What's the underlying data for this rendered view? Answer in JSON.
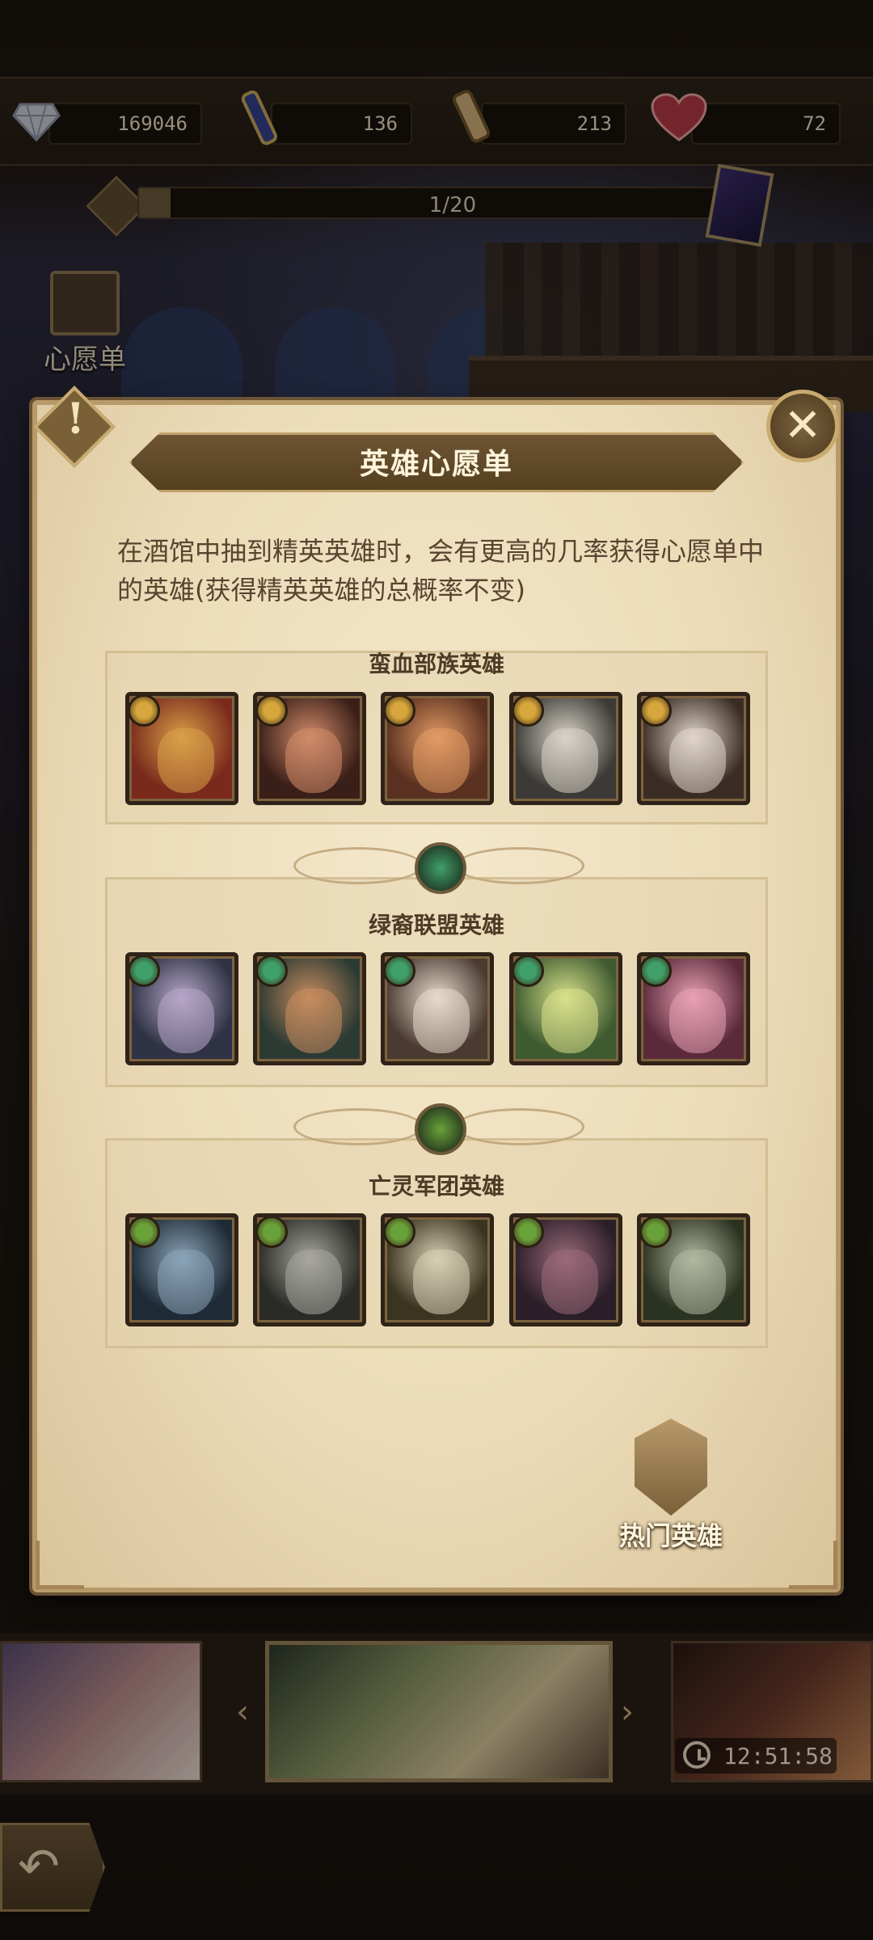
{
  "resources": {
    "diamonds": "169046",
    "scrolls_purple": "136",
    "scrolls_gold": "213",
    "hearts": "72"
  },
  "summon_progress": {
    "text": "1/20",
    "fraction": 0.05
  },
  "side_nav": {
    "wishlist_label": "心愿单"
  },
  "modal": {
    "title": "英雄心愿单",
    "description": "在酒馆中抽到精英英雄时，会有更高的几率获得心愿单中的英雄(获得精英英雄的总概率不变)",
    "sections": [
      {
        "title": "蛮血部族英雄",
        "badge_color": "#d7a63c",
        "heroes": [
          "hero-1",
          "hero-2",
          "hero-3",
          "hero-4",
          "hero-5"
        ]
      },
      {
        "title": "绿裔联盟英雄",
        "badge_color": "#3fa06a",
        "heroes": [
          "hero-1",
          "hero-2",
          "hero-3",
          "hero-4",
          "hero-5"
        ]
      },
      {
        "title": "亡灵军团英雄",
        "badge_color": "#6aa23a",
        "heroes": [
          "hero-1",
          "hero-2",
          "hero-3",
          "hero-4",
          "hero-5"
        ]
      }
    ],
    "hot_heroes_label": "热门英雄"
  },
  "banner": {
    "timer": "12:51:58"
  },
  "colors": {
    "parchment": "#ecdcb8",
    "title_bar": "#6e5434",
    "text_brown": "#5a4330",
    "faction_gold": "#d7a63c",
    "faction_green": "#3fa06a",
    "faction_undead": "#6aa23a"
  },
  "icons": {
    "diamond": "diamond-icon",
    "purple_scroll": "purple-scroll-icon",
    "gold_scroll": "gold-scroll-icon",
    "heart": "heart-icon",
    "book": "book-icon",
    "close": "close-icon",
    "alert": "alert-icon",
    "back": "back-arrow-icon",
    "clock": "clock-icon"
  }
}
